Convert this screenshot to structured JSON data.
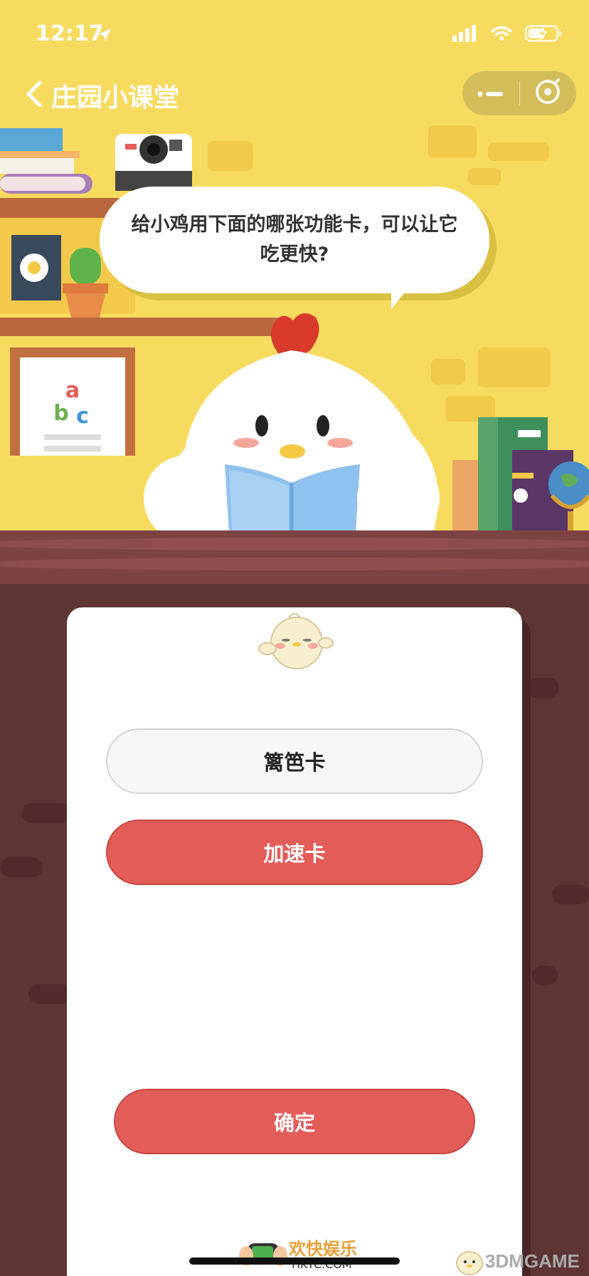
{
  "status_bar": {
    "time": "12:17"
  },
  "nav": {
    "title": "庄园小课堂",
    "more_icon": "more-dots-icon",
    "close_icon": "close-circle-icon"
  },
  "question": {
    "text": "给小鸡用下面的哪张功能卡，可以让它吃更快?"
  },
  "options": [
    {
      "label": "篱笆卡",
      "selected": false
    },
    {
      "label": "加速卡",
      "selected": true
    }
  ],
  "confirm_button": {
    "label": "确定"
  },
  "scene_decor": {
    "poster_letters": [
      "a",
      "b",
      "c"
    ]
  },
  "watermarks": {
    "site1_cn": "欢快娱乐",
    "site1_en": "HKYC.COM",
    "site2": "3DMGAME"
  },
  "colors": {
    "scene_bg": "#f7db5f",
    "accent_red": "#e25c58",
    "table_brown": "#7d4342",
    "wall_brown": "#5e3434"
  }
}
